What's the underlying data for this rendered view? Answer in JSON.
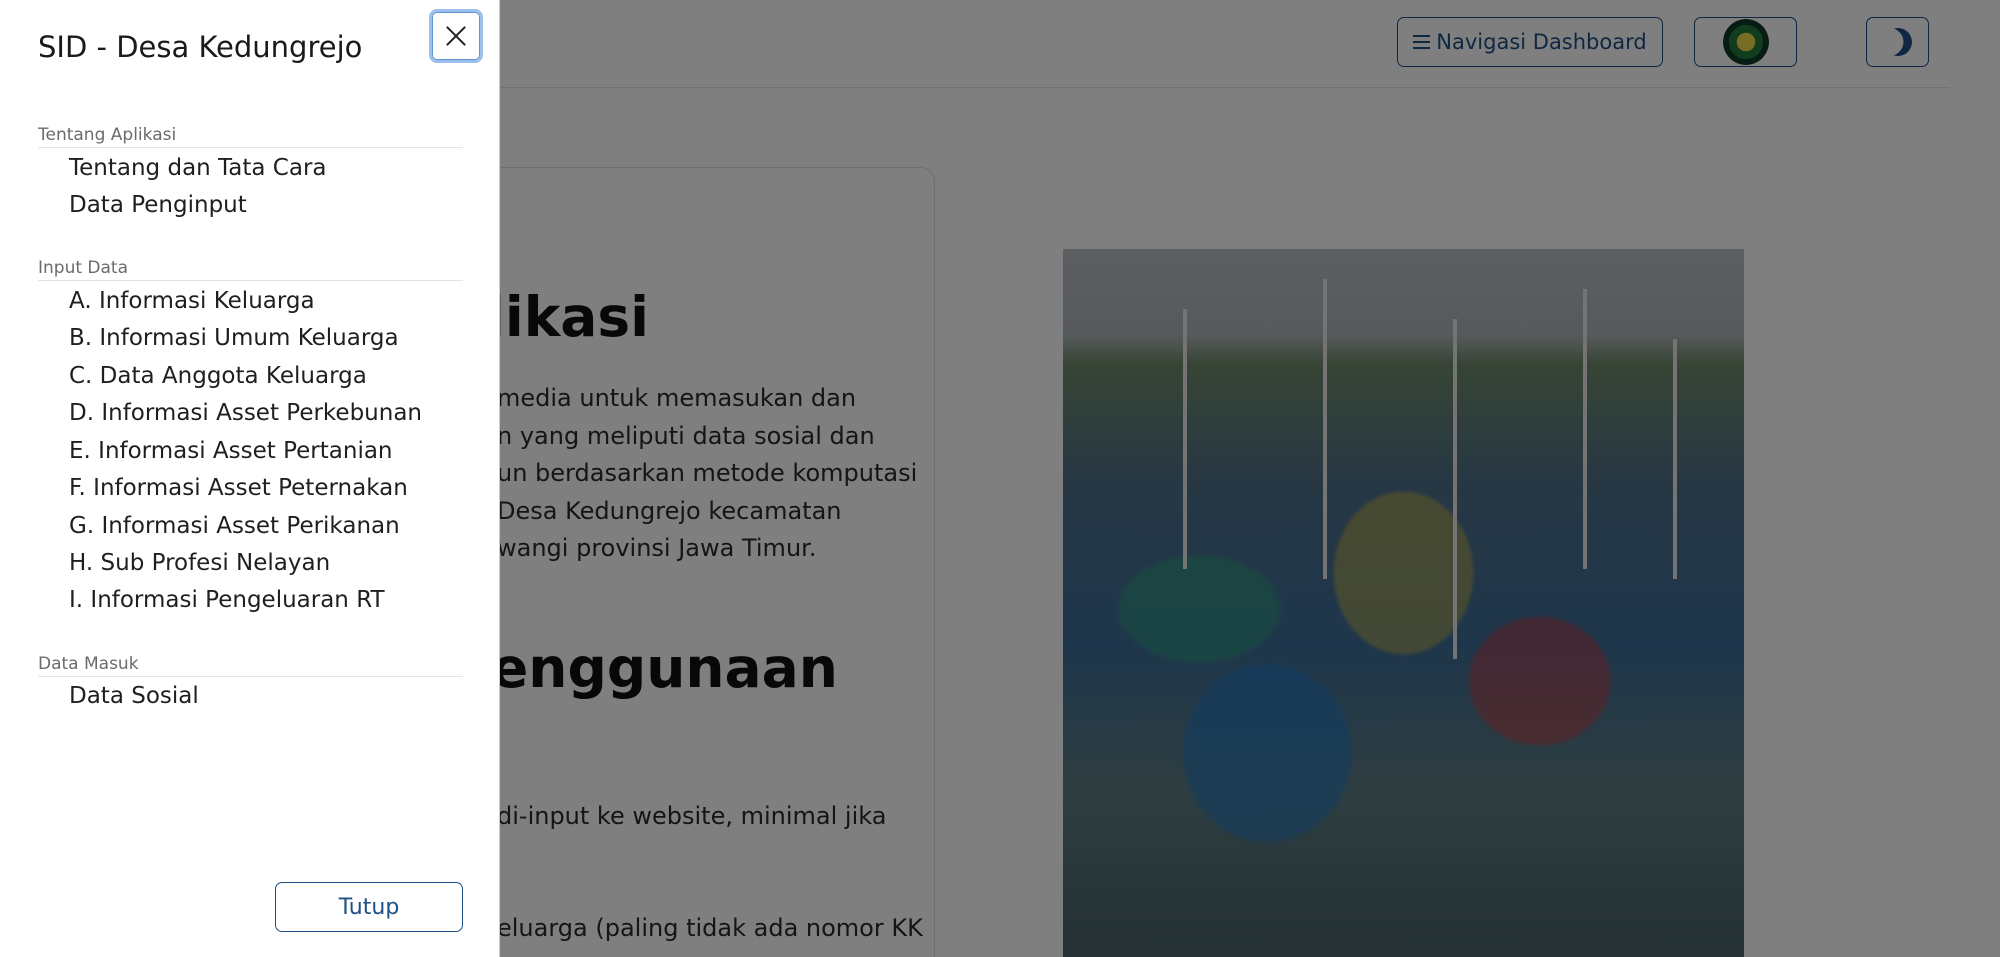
{
  "navbar": {
    "dashboard_button": "Navigasi Dashboard",
    "dashboard_icon": "hamburger-icon",
    "logo_icon": "regency-emblem-icon",
    "theme_icon": "moon-icon"
  },
  "content": {
    "title_1": "likasi",
    "paragraph_1": [
      "media untuk memasukan dan",
      "n yang meliputi data sosial dan",
      "un berdasarkan metode komputasi",
      "Desa Kedungrejo kecamatan",
      "wangi provinsi Jawa Timur."
    ],
    "title_2": "enggunaan",
    "paragraph_2": [
      "di-input ke website, minimal jika"
    ],
    "paragraph_3": [
      "eluarga (paling tidak ada nomor KK"
    ]
  },
  "offcanvas": {
    "title": "SID - Desa Kedungrejo",
    "close_icon": "close-icon",
    "sections": [
      {
        "label": "Tentang Aplikasi",
        "items": [
          "Tentang dan Tata Cara",
          "Data Penginput"
        ]
      },
      {
        "label": "Input Data",
        "items": [
          "A. Informasi Keluarga",
          "B. Informasi Umum Keluarga",
          "C. Data Anggota Keluarga",
          "D. Informasi Asset Perkebunan",
          "E. Informasi Asset Pertanian",
          "F. Informasi Asset Peternakan",
          "G. Informasi Asset Perikanan",
          "H. Sub Profesi Nelayan",
          "I. Informasi Pengeluaran RT"
        ]
      },
      {
        "label": "Data Masuk",
        "items": [
          "Data Sosial"
        ]
      }
    ],
    "close_button": "Tutup"
  },
  "colors": {
    "accent": "#1e4f86",
    "focus_ring": "#9cc0ea",
    "backdrop": "rgba(0,0,0,0.5)"
  }
}
